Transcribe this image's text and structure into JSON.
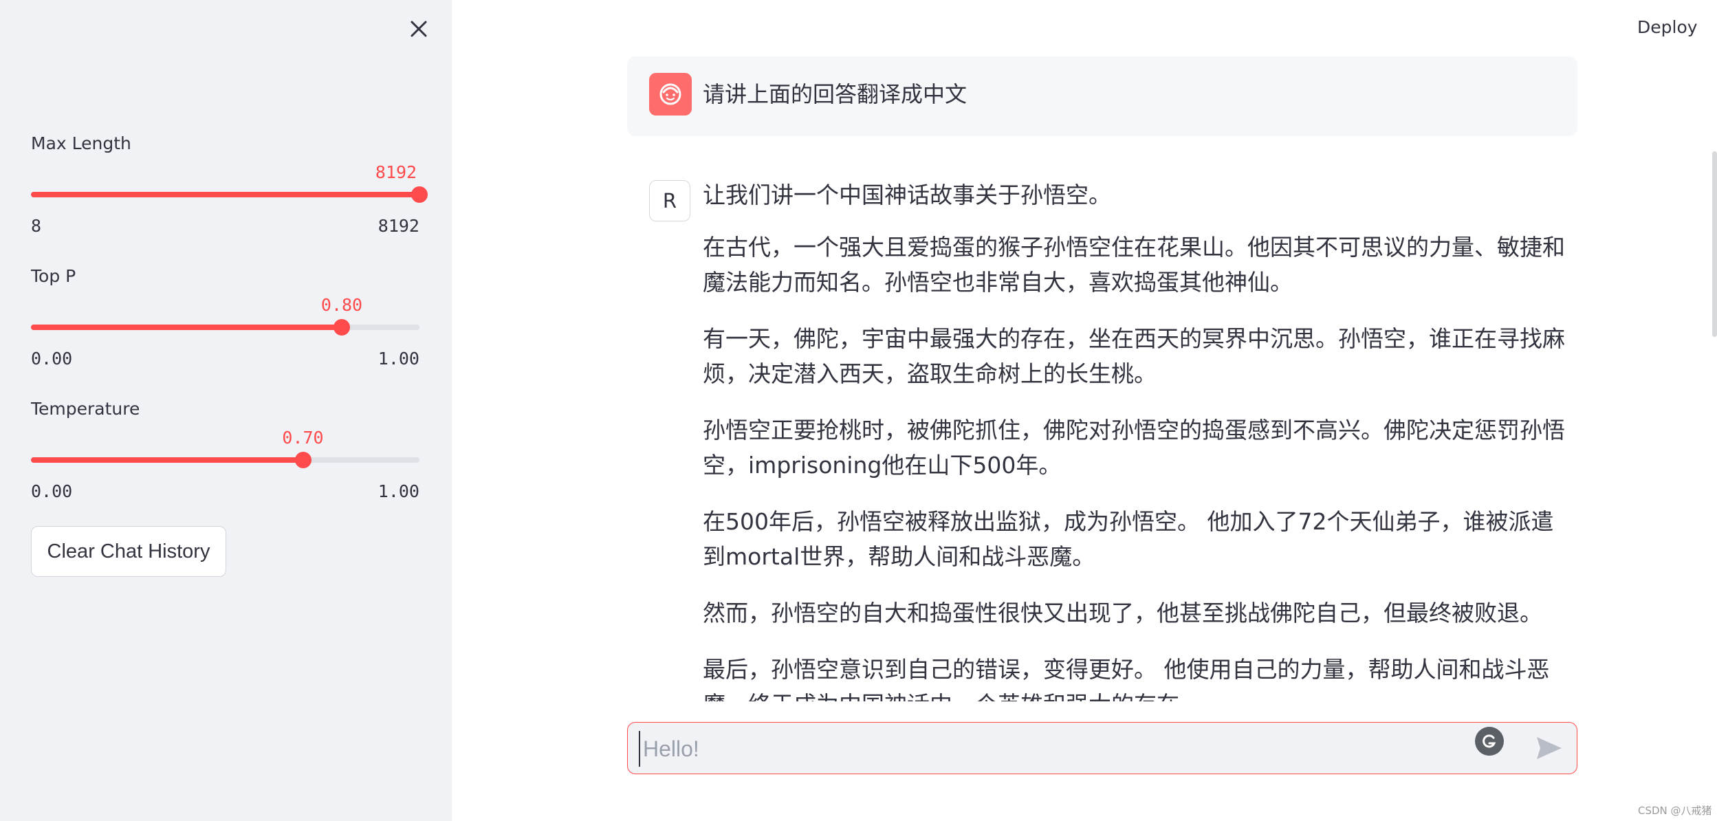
{
  "sidebar": {
    "close_icon": "close-icon",
    "sliders": [
      {
        "label": "Max Length",
        "value_label": "8192",
        "min_label": "8",
        "max_label": "8192",
        "fraction": 1.0
      },
      {
        "label": "Top P",
        "value_label": "0.80",
        "min_label": "0.00",
        "max_label": "1.00",
        "fraction": 0.8
      },
      {
        "label": "Temperature",
        "value_label": "0.70",
        "min_label": "0.00",
        "max_label": "1.00",
        "fraction": 0.7
      }
    ],
    "clear_button": "Clear Chat History"
  },
  "header": {
    "deploy": "Deploy"
  },
  "chat": {
    "user_message": "请讲上面的回答翻译成中文",
    "assistant_avatar": "R",
    "assistant_paragraphs": [
      "让我们讲一个中国神话故事关于孙悟空。",
      "在古代，一个强大且爱捣蛋的猴子孙悟空住在花果山。他因其不可思议的力量、敏捷和魔法能力而知名。孙悟空也非常自大，喜欢捣蛋其他神仙。",
      "有一天，佛陀，宇宙中最强大的存在，坐在西天的冥界中沉思。孙悟空，谁正在寻找麻烦，决定潜入西天，盗取生命树上的长生桃。",
      "孙悟空正要抢桃时，被佛陀抓住，佛陀对孙悟空的捣蛋感到不高兴。佛陀决定惩罚孙悟空，imprisoning他在山下500年。",
      "在500年后，孙悟空被释放出监狱，成为孙悟空。 他加入了72个天仙弟子，谁被派遣到mortal世界，帮助人间和战斗恶魔。",
      "然而，孙悟空的自大和捣蛋性很快又出现了，他甚至挑战佛陀自己，但最终被败退。",
      "最后，孙悟空意识到自己的错误，变得更好。 他使用自己的力量，帮助人间和战斗恶魔，终于成为中国神话中一个英雄和强大的存在。"
    ],
    "input_placeholder": "Hello!"
  },
  "watermark": "CSDN @八戒猪",
  "colors": {
    "accent": "#ff4b4b",
    "sidebar_bg": "#f0f2f6",
    "user_bubble": "#f6f7f9"
  }
}
